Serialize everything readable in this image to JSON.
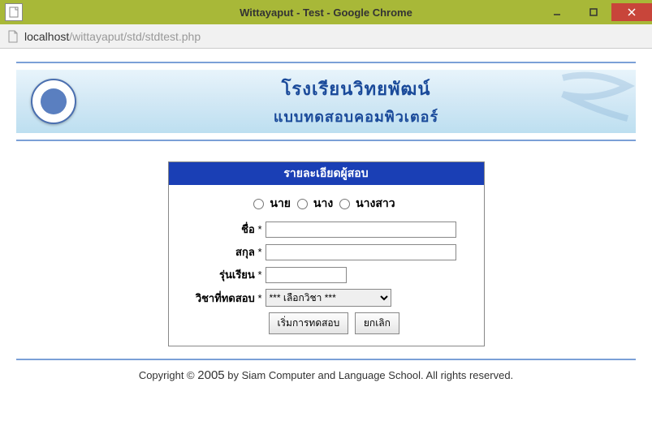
{
  "window": {
    "title": "Wittayaput - Test - Google Chrome"
  },
  "address": {
    "host": "localhost",
    "path": "/wittayaput/std/stdtest.php"
  },
  "banner": {
    "line1": "โรงเรียนวิทยพัฒน์",
    "line2": "แบบทดสอบคอมพิวเตอร์"
  },
  "form": {
    "header": "รายละเอียดผู้สอบ",
    "titles": {
      "opt1": "นาย",
      "opt2": "นาง",
      "opt3": "นางสาว"
    },
    "labels": {
      "firstname": "ชื่อ",
      "lastname": "สกุล",
      "class": "รุ่นเรียน",
      "subject": "วิชาที่ทดสอบ"
    },
    "asterisk": "*",
    "select_placeholder": "*** เลือกวิชา ***",
    "buttons": {
      "start": "เริ่มการทดสอบ",
      "cancel": "ยกเลิก"
    }
  },
  "footer": {
    "prefix": "Copyright © ",
    "year": "2005",
    "suffix": " by Siam Computer and Language School. All rights reserved."
  }
}
